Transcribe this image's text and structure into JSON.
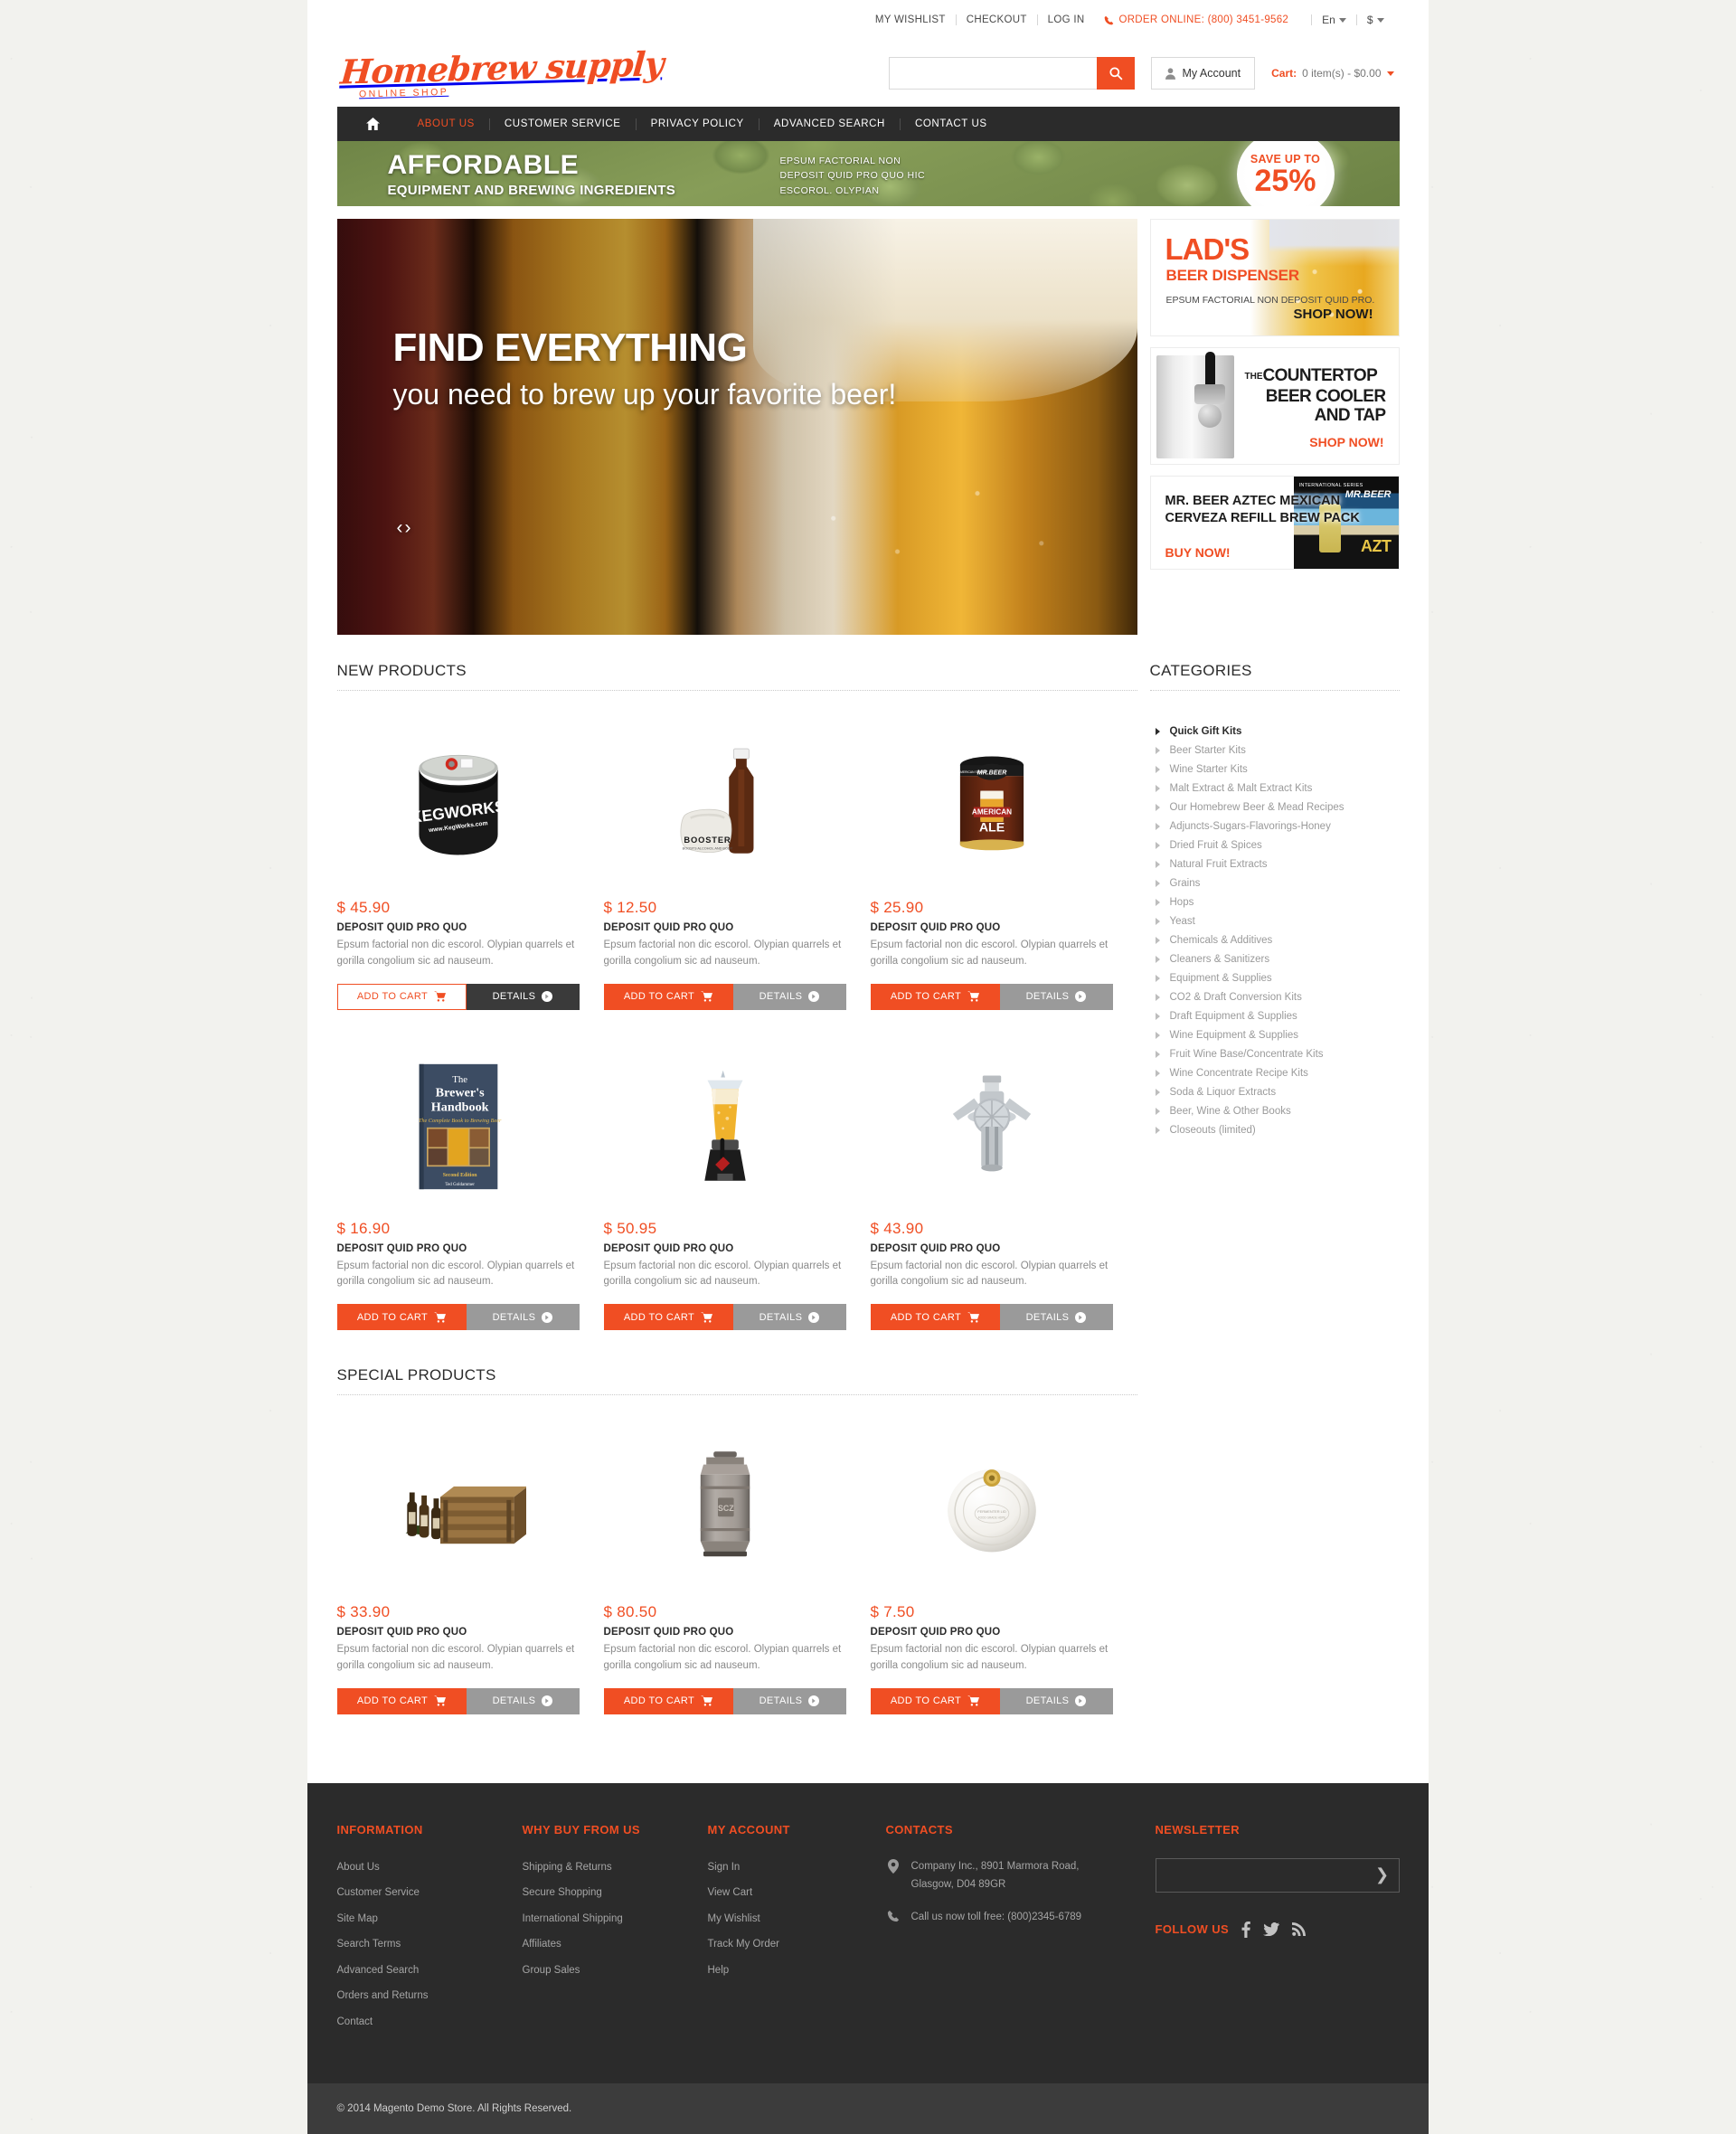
{
  "topbar": {
    "links": [
      "My Wishlist",
      "Checkout",
      "Log In"
    ],
    "phone_label": "Order Online: (800) 3451-9562",
    "language": "En",
    "currency": "$"
  },
  "header": {
    "brand": "Homebrew supply",
    "brand_sub": "ONLINE SHOP",
    "search_placeholder": "",
    "search_value": "",
    "account_label": "My Account",
    "cart_label": "Cart:",
    "cart_value": "0 item(s) - $0.00"
  },
  "nav": {
    "items": [
      {
        "label": "About Us",
        "active": true
      },
      {
        "label": "Customer Service",
        "active": false
      },
      {
        "label": "Privacy Policy",
        "active": false
      },
      {
        "label": "Advanced Search",
        "active": false
      },
      {
        "label": "Contact Us",
        "active": false
      }
    ]
  },
  "promo": {
    "title": "AFFORDABLE",
    "subtitle": "EQUIPMENT AND BREWING INGREDIENTS",
    "text_line1": "EPSUM FACTORIAL NON",
    "text_line2": "DEPOSIT QUID PRO QUO HIC",
    "text_line3": "ESCOROL. OLYPIAN",
    "badge_top": "SAVE UP TO",
    "badge_value": "25%"
  },
  "hero": {
    "headline": "FIND EVERYTHING",
    "subline": "you need to brew up your favorite beer!",
    "prev": "‹",
    "next": "›"
  },
  "banners": [
    {
      "title": "LAD'S",
      "subtitle": "BEER DISPENSER",
      "text": "EPSUM FACTORIAL NON DEPOSIT QUID PRO.",
      "cta": "SHOP NOW!"
    },
    {
      "the": "THE",
      "line1": "COUNTERTOP",
      "line2": "BEER COOLER",
      "line3": "AND TAP",
      "cta": "SHOP NOW!"
    },
    {
      "title": "MR. BEER AZTEC MEXICAN CERVEZA REFILL BREW PACK",
      "cta": "BUY NOW!",
      "can_brand": "MR.BEER",
      "can_name": "AZT",
      "can_series": "INTERNATIONAL SERIES"
    }
  ],
  "sections": {
    "new_products_title": "NEW PRODUCTS",
    "special_products_title": "SPECIAL PRODUCTS"
  },
  "buttons": {
    "add_to_cart": "ADD TO CART",
    "details": "DETAILS"
  },
  "new_products": [
    {
      "price": "$ 45.90",
      "name": "DEPOSIT QUID PRO QUO",
      "desc": "Epsum factorial non dic escorol. Olypian quarrels et gorilla congolium sic ad nauseum.",
      "image": "keg-cooler",
      "hover": true
    },
    {
      "price": "$ 12.50",
      "name": "DEPOSIT QUID PRO QUO",
      "desc": "Epsum factorial non dic escorol. Olypian quarrels et gorilla congolium sic ad nauseum.",
      "image": "bottle-booster",
      "hover": false
    },
    {
      "price": "$ 25.90",
      "name": "DEPOSIT QUID PRO QUO",
      "desc": "Epsum factorial non dic escorol. Olypian quarrels et gorilla congolium sic ad nauseum.",
      "image": "american-ale-can",
      "hover": false
    },
    {
      "price": "$ 16.90",
      "name": "DEPOSIT QUID PRO QUO",
      "desc": "Epsum factorial non dic escorol. Olypian quarrels et gorilla congolium sic ad nauseum.",
      "image": "brewers-handbook-book",
      "hover": false
    },
    {
      "price": "$ 50.95",
      "name": "DEPOSIT QUID PRO QUO",
      "desc": "Epsum factorial non dic escorol. Olypian quarrels et gorilla congolium sic ad nauseum.",
      "image": "beer-tower-dispenser",
      "hover": false
    },
    {
      "price": "$ 43.90",
      "name": "DEPOSIT QUID PRO QUO",
      "desc": "Epsum factorial non dic escorol. Olypian quarrels et gorilla congolium sic ad nauseum.",
      "image": "keg-tap-coupler",
      "hover": false
    }
  ],
  "special_products": [
    {
      "price": "$ 33.90",
      "name": "DEPOSIT QUID PRO QUO",
      "desc": "Epsum factorial non dic escorol. Olypian quarrels et gorilla congolium sic ad nauseum.",
      "image": "wooden-bottle-crate",
      "hover": false
    },
    {
      "price": "$ 80.50",
      "name": "DEPOSIT QUID PRO QUO",
      "desc": "Epsum factorial non dic escorol. Olypian quarrels et gorilla congolium sic ad nauseum.",
      "image": "steel-keg",
      "hover": false
    },
    {
      "price": "$ 7.50",
      "name": "DEPOSIT QUID PRO QUO",
      "desc": "Epsum factorial non dic escorol. Olypian quarrels et gorilla congolium sic ad nauseum.",
      "image": "fermenter-lid",
      "hover": false
    }
  ],
  "categories": {
    "title": "CATEGORIES",
    "items": [
      "Quick Gift Kits",
      "Beer Starter Kits",
      "Wine Starter Kits",
      "Malt Extract & Malt Extract Kits",
      "Our Homebrew Beer & Mead Recipes",
      "Adjuncts-Sugars-Flavorings-Honey",
      "Dried Fruit & Spices",
      "Natural Fruit Extracts",
      "Grains",
      "Hops",
      "Yeast",
      "Chemicals & Additives",
      "Cleaners & Sanitizers",
      "Equipment & Supplies",
      "CO2 & Draft Conversion Kits",
      "Draft Equipment & Supplies",
      "Wine Equipment & Supplies",
      "Fruit Wine Base/Concentrate Kits",
      "Wine Concentrate Recipe Kits",
      "Soda & Liquor Extracts",
      "Beer, Wine & Other Books",
      "Closeouts (limited)"
    ]
  },
  "footer": {
    "columns": [
      {
        "heading": "INFORMATION",
        "links": [
          "About Us",
          "Customer Service",
          "Site Map",
          "Search Terms",
          "Advanced Search",
          "Orders and Returns",
          "Contact"
        ]
      },
      {
        "heading": "WHY BUY FROM US",
        "links": [
          "Shipping & Returns",
          "Secure Shopping",
          "International Shipping",
          "Affiliates",
          "Group Sales"
        ]
      },
      {
        "heading": "MY ACCOUNT",
        "links": [
          "Sign In",
          "View Cart",
          "My Wishlist",
          "Track My Order",
          "Help"
        ]
      }
    ],
    "contacts": {
      "heading": "CONTACTS",
      "address_line1": "Company Inc., 8901 Marmora Road,",
      "address_line2": "Glasgow, D04 89GR",
      "phone": "Call us now toll free: (800)2345-6789"
    },
    "newsletter": {
      "heading": "NEWSLETTER",
      "placeholder": "",
      "value": "",
      "submit": "❯"
    },
    "follow": {
      "label": "FOLLOW US",
      "networks": [
        "facebook",
        "twitter",
        "rss"
      ]
    },
    "copyright": "© 2014 Magento Demo Store. All Rights Reserved."
  },
  "colors": {
    "accent": "#f04e23",
    "dark": "#2b2b2b",
    "muted": "#9a9a9a"
  }
}
